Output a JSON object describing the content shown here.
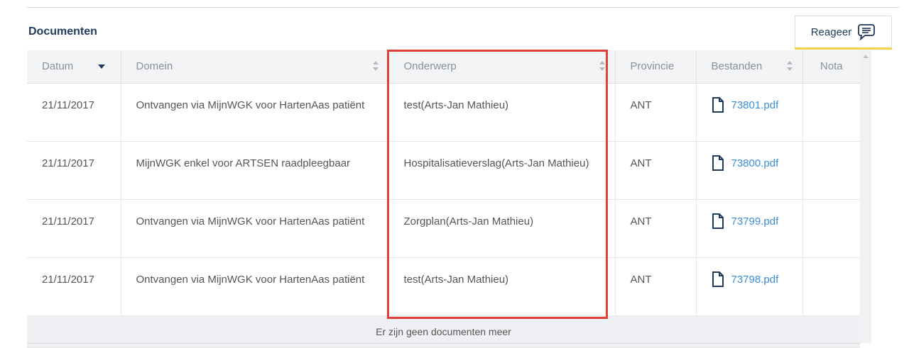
{
  "panel": {
    "title": "Documenten"
  },
  "reageer": {
    "label": "Reageer",
    "icon": "chat-comment-icon"
  },
  "table": {
    "headers": [
      "Datum",
      "Domein",
      "Onderwerp",
      "Provincie",
      "Bestanden",
      "Nota"
    ],
    "rows": [
      {
        "datum": "21/11/2017",
        "domein": "Ontvangen via MijnWGK voor HartenAas patiënt",
        "onderwerp": "test(Arts-Jan Mathieu)",
        "provincie": "ANT",
        "bestand": "73801.pdf",
        "nota": ""
      },
      {
        "datum": "21/11/2017",
        "domein": "MijnWGK enkel voor ARTSEN raadpleegbaar",
        "onderwerp": "Hospitalisatieverslag(Arts-Jan Mathieu)",
        "provincie": "ANT",
        "bestand": "73800.pdf",
        "nota": ""
      },
      {
        "datum": "21/11/2017",
        "domein": "Ontvangen via MijnWGK voor HartenAas patiënt",
        "onderwerp": "Zorgplan(Arts-Jan Mathieu)",
        "provincie": "ANT",
        "bestand": "73799.pdf",
        "nota": ""
      },
      {
        "datum": "21/11/2017",
        "domein": "Ontvangen via MijnWGK voor HartenAas patiënt",
        "onderwerp": "test(Arts-Jan Mathieu)",
        "provincie": "ANT",
        "bestand": "73798.pdf",
        "nota": ""
      }
    ],
    "footer": "Er zijn geen documenten meer"
  },
  "colors": {
    "title": "#1f3a5c",
    "link": "#3a8ed8",
    "highlight": "#e0423a",
    "accent": "#f3d14a"
  }
}
